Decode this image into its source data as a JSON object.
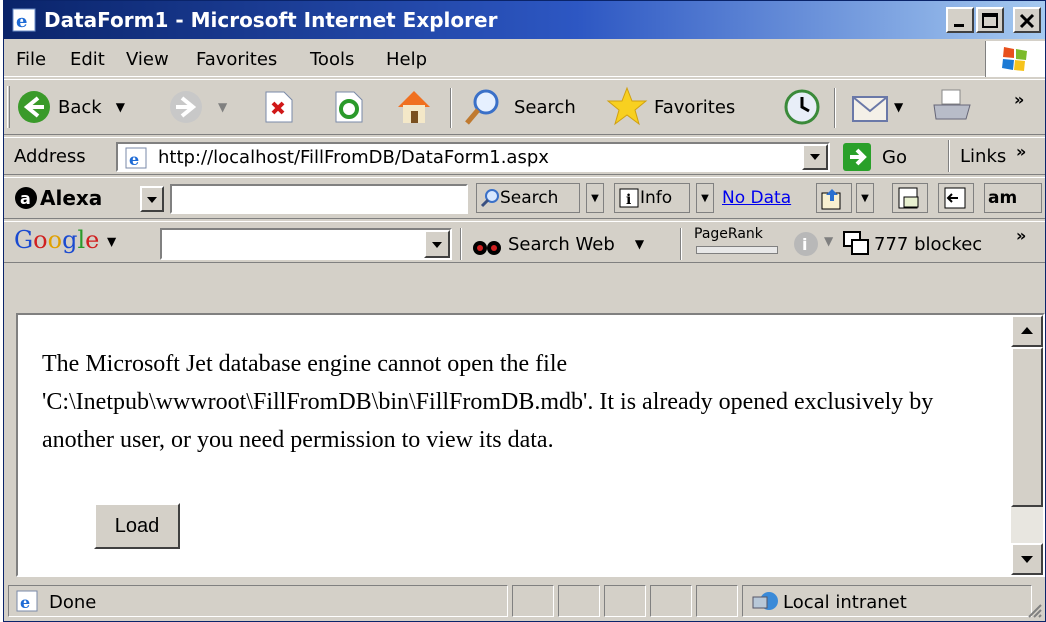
{
  "window": {
    "title": "DataForm1 - Microsoft Internet Explorer"
  },
  "menu": {
    "items": [
      {
        "label": "File"
      },
      {
        "label": "Edit"
      },
      {
        "label": "View"
      },
      {
        "label": "Favorites"
      },
      {
        "label": "Tools"
      },
      {
        "label": "Help"
      }
    ]
  },
  "toolbar": {
    "back_label": "Back",
    "search_label": "Search",
    "favorites_label": "Favorites",
    "chevron": "»"
  },
  "address": {
    "label": "Address",
    "url": "http://localhost/FillFromDB/DataForm1.aspx",
    "go_label": "Go",
    "links_label": "Links",
    "chevron": "»"
  },
  "alexa": {
    "brand": "Alexa",
    "search_label": "Search",
    "info_label": "Info",
    "no_data_label": "No Data",
    "amazon_label": "am"
  },
  "google": {
    "brand_letters": [
      "G",
      "o",
      "o",
      "g",
      "l",
      "e"
    ],
    "search_web_label": "Search Web",
    "pagerank_label": "PageRank",
    "popups_label": "777 blockec",
    "chevron": "»"
  },
  "page": {
    "error_message": "The Microsoft Jet database engine cannot open the file 'C:\\Inetpub\\wwwroot\\FillFromDB\\bin\\FillFromDB.mdb'. It is already opened exclusively by another user, or you need permission to view its data.",
    "load_button_label": "Load"
  },
  "status": {
    "text": "Done",
    "zone_label": "Local intranet"
  },
  "colors": {
    "titlebar_start": "#0a246a",
    "titlebar_end": "#a6caf0",
    "chrome": "#d4d0c8",
    "link": "#0000ee"
  }
}
